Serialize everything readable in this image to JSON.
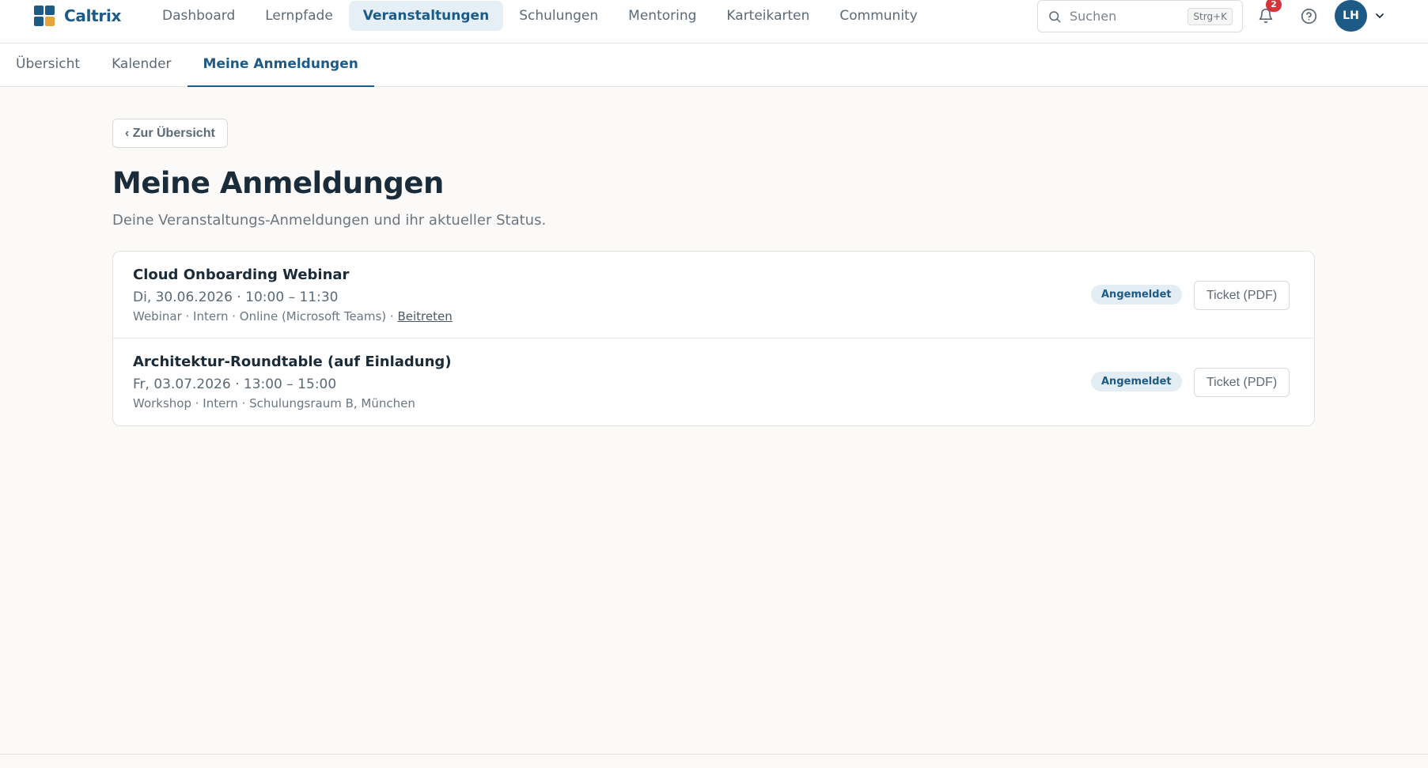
{
  "app": {
    "brand": "Caltrix",
    "logo_colors": [
      "#1d5a86",
      "#1d5a86",
      "#1d5a86",
      "#e8a23a"
    ]
  },
  "mainnav": {
    "items": [
      {
        "label": "Dashboard",
        "active": false
      },
      {
        "label": "Lernpfade",
        "active": false
      },
      {
        "label": "Veranstaltungen",
        "active": true
      },
      {
        "label": "Schulungen",
        "active": false
      },
      {
        "label": "Mentoring",
        "active": false
      },
      {
        "label": "Karteikarten",
        "active": false
      },
      {
        "label": "Community",
        "active": false
      }
    ]
  },
  "search": {
    "placeholder": "Suchen",
    "shortcut": "Strg+K"
  },
  "notifications": {
    "count": "2"
  },
  "user": {
    "initials": "LH"
  },
  "subnav": {
    "tabs": [
      {
        "label": "Übersicht",
        "active": false
      },
      {
        "label": "Kalender",
        "active": false
      },
      {
        "label": "Meine Anmeldungen",
        "active": true
      }
    ]
  },
  "page": {
    "back_label": "‹ Zur Übersicht",
    "title": "Meine Anmeldungen",
    "subtitle": "Deine Veranstaltungs-Anmeldungen und ihr aktueller Status."
  },
  "registrations": [
    {
      "title": "Cloud Onboarding Webinar",
      "date": "Di, 30.06.2026 · 10:00 – 11:30",
      "meta": "Webinar · Intern · Online (Microsoft Teams) · ",
      "link": "Beitreten",
      "status": "Angemeldet",
      "ticket": "Ticket (PDF)"
    },
    {
      "title": "Architektur-Roundtable (auf Einladung)",
      "date": "Fr, 03.07.2026 · 13:00 – 15:00",
      "meta": "Workshop · Intern · Schulungsraum B, München",
      "link": "",
      "status": "Angemeldet",
      "ticket": "Ticket (PDF)"
    }
  ],
  "colors": {
    "accent": "#1d5a86",
    "badge": "#d7333a",
    "status_bg": "#e3edf4"
  }
}
